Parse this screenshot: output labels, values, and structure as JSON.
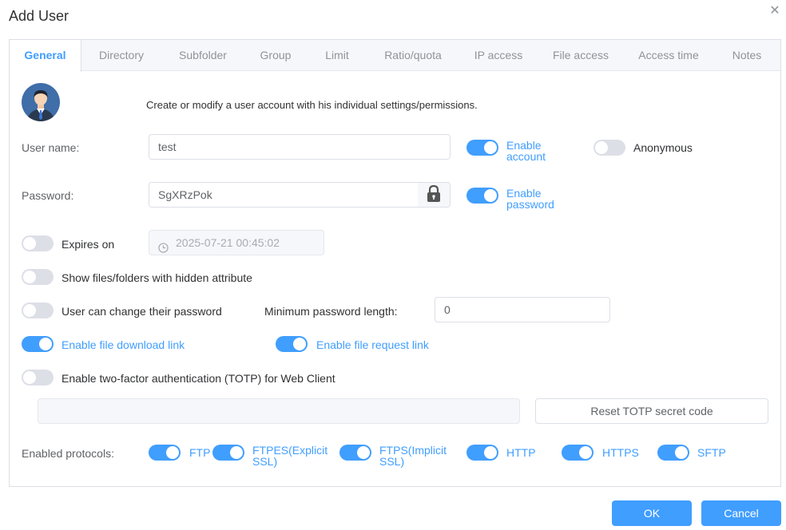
{
  "dialog": {
    "title": "Add User",
    "close_glyph": "✕"
  },
  "tabs": [
    {
      "label": "General",
      "active": true
    },
    {
      "label": "Directory"
    },
    {
      "label": "Subfolder"
    },
    {
      "label": "Group"
    },
    {
      "label": "Limit"
    },
    {
      "label": "Ratio/quota"
    },
    {
      "label": "IP access"
    },
    {
      "label": "File access"
    },
    {
      "label": "Access time"
    },
    {
      "label": "Notes"
    }
  ],
  "general": {
    "intro": "Create or modify a user account with his individual settings/permissions.",
    "username_label": "User name:",
    "username_value": "test",
    "enable_account_label": "Enable account",
    "anonymous_label": "Anonymous",
    "password_label": "Password:",
    "password_value": "SgXRzPok",
    "enable_password_label": "Enable password",
    "expires_label": "Expires on",
    "expires_value": "2025-07-21 00:45:02",
    "hidden_label": "Show files/folders with hidden attribute",
    "change_password_label": "User can change their password",
    "min_length_label": "Minimum password length:",
    "min_length_value": "0",
    "download_link_label": "Enable file download link",
    "request_link_label": "Enable file request link",
    "totp_label": "Enable two-factor authentication (TOTP) for Web Client",
    "totp_secret_value": "",
    "reset_totp_label": "Reset TOTP secret code",
    "protocols_label": "Enabled protocols:",
    "protocols": [
      {
        "label": "FTP",
        "on": true
      },
      {
        "label": "FTPES(Explicit SSL)",
        "on": true
      },
      {
        "label": "FTPS(Implicit SSL)",
        "on": true
      },
      {
        "label": "HTTP",
        "on": true
      },
      {
        "label": "HTTPS",
        "on": true
      },
      {
        "label": "SFTP",
        "on": true
      }
    ]
  },
  "footer": {
    "ok_label": "OK",
    "cancel_label": "Cancel"
  },
  "colors": {
    "accent": "#409eff",
    "switch_off": "#dcdfe6",
    "border": "#dcdfe6"
  },
  "icons": {
    "avatar": "user-avatar-icon",
    "lock": "lock-icon",
    "clock": "clock-icon",
    "close": "close-icon"
  }
}
